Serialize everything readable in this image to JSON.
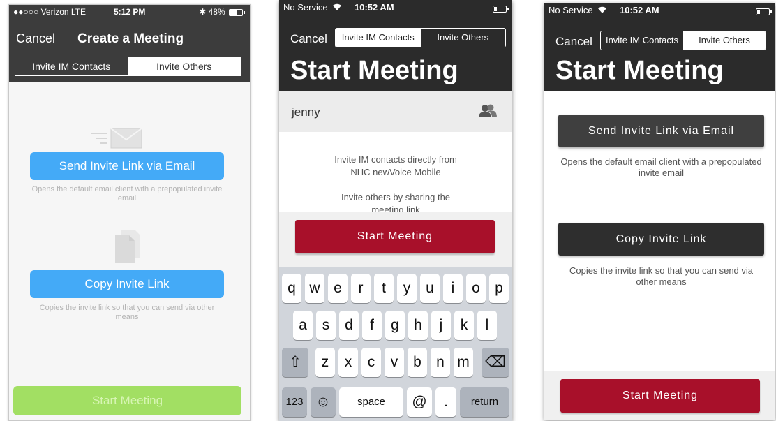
{
  "screen1": {
    "status": {
      "carrier": "●●○○○ Verizon  LTE",
      "time": "5:12 PM",
      "bluetooth": "✱",
      "battery": "48%"
    },
    "nav": {
      "cancel": "Cancel",
      "title": "Create a Meeting"
    },
    "tabs": [
      "Invite IM Contacts",
      "Invite Others"
    ],
    "email": {
      "button": "Send Invite Link via Email",
      "desc": "Opens the default email client with a prepopulated invite email"
    },
    "copy": {
      "button": "Copy Invite Link",
      "desc": "Copies the invite link so that you can send via other means"
    },
    "start": "Start Meeting",
    "colors": {
      "accent": "#44aaf7",
      "start": "#a2df63",
      "header": "#3c3c3c"
    }
  },
  "screen2": {
    "status": {
      "carrier": "No Service",
      "wifi": "wifi-icon",
      "time": "10:52 AM"
    },
    "nav": {
      "cancel": "Cancel",
      "tabs": [
        "Invite IM Contacts",
        "Invite Others"
      ]
    },
    "title": "Start Meeting",
    "input": {
      "value": "jenny",
      "icon": "contacts-icon"
    },
    "info": [
      "Invite IM contacts directly from",
      "NHC newVoice Mobile",
      "Invite others by sharing the",
      "meeting link"
    ],
    "start": "Start Meeting",
    "keyboard": {
      "row1": [
        "q",
        "w",
        "e",
        "r",
        "t",
        "y",
        "u",
        "i",
        "o",
        "p"
      ],
      "row2": [
        "a",
        "s",
        "d",
        "f",
        "g",
        "h",
        "j",
        "k",
        "l"
      ],
      "row3": [
        "z",
        "x",
        "c",
        "v",
        "b",
        "n",
        "m"
      ],
      "shift": "⇧",
      "delete": "⌫",
      "numbers": "123",
      "emoji": "☺",
      "space": "space",
      "at": "@",
      "period": ".",
      "return": "return"
    },
    "colors": {
      "brand": "#a8102a",
      "header": "#2b2b2b"
    }
  },
  "screen3": {
    "status": {
      "carrier": "No Service",
      "time": "10:52 AM"
    },
    "nav": {
      "cancel": "Cancel",
      "tabs": [
        "Invite IM Contacts",
        "Invite Others"
      ]
    },
    "title": "Start Meeting",
    "email": {
      "button": "Send Invite Link via Email",
      "desc": "Opens the default email client with a prepopulated invite email"
    },
    "copy": {
      "button": "Copy Invite Link",
      "desc": "Copies the invite link so that you can send via other means"
    },
    "start": "Start Meeting",
    "colors": {
      "email_btn": "#3f3f3f",
      "copy_btn": "#2e2e2e",
      "brand": "#a8102a"
    }
  }
}
